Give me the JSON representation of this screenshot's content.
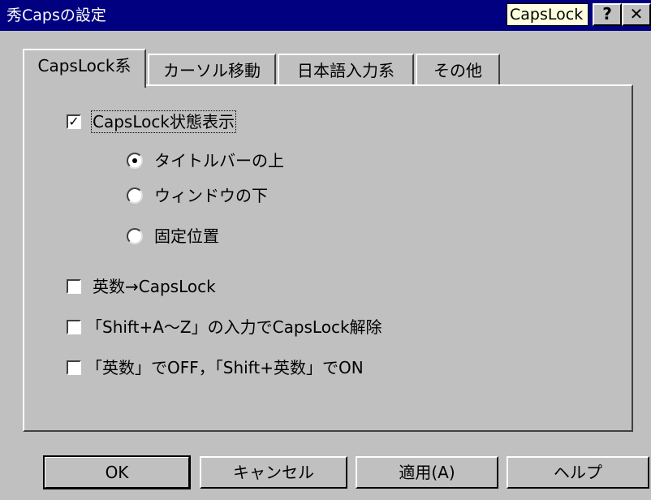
{
  "window": {
    "title": "秀Capsの設定",
    "caps_indicator": "CapsLock",
    "help_button": "?",
    "close_button": "✕"
  },
  "tabs": [
    {
      "label": "CapsLock系",
      "active": true
    },
    {
      "label": "カーソル移動",
      "active": false
    },
    {
      "label": "日本語入力系",
      "active": false
    },
    {
      "label": "その他",
      "active": false
    }
  ],
  "options": {
    "show_state": {
      "label": "CapsLock状態表示",
      "checked": true
    },
    "radios": [
      {
        "label": "タイトルバーの上",
        "selected": true
      },
      {
        "label": "ウィンドウの下",
        "selected": false
      },
      {
        "label": "固定位置",
        "selected": false
      }
    ],
    "checkboxes": [
      {
        "label": "英数→CapsLock",
        "checked": false
      },
      {
        "label": "「Shift+A～Z」の入力でCapsLock解除",
        "checked": false
      },
      {
        "label": "「英数」でOFF，「Shift+英数」でON",
        "checked": false
      }
    ]
  },
  "buttons": {
    "ok": "OK",
    "cancel": "キャンセル",
    "apply": "適用(A)",
    "help": "ヘルプ"
  },
  "colors": {
    "titlebar": "#000080",
    "face": "#c0c0c0",
    "tooltip": "#ffffe1"
  }
}
